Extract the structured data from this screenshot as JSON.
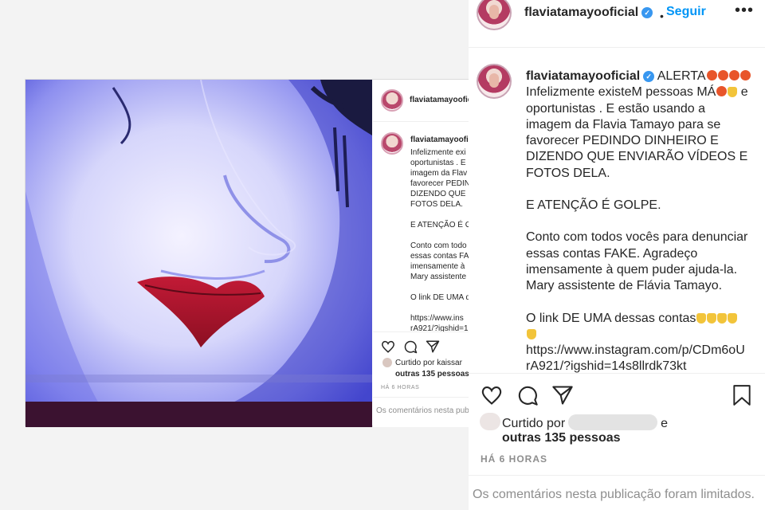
{
  "small_post": {
    "username": "flaviatamayoofici",
    "caption_username": "flaviatamayoofi",
    "caption_lines": "Infelizmente exi\noportunistas . E\nimagem da Flav\nfavorecer PEDIN\nDIZENDO QUE E\nFOTOS DELA.\n\nE ATENÇÃO É G\n\nConto com todo\nessas contas FA\nimensamente à\nMary assistente\n\nO link DE UMA d\n\nhttps://www.ins\nrA921/?igshid=1",
    "liked_by": "Curtido por kaissar",
    "liked_others": "outras 135 pessoas",
    "time": "HÁ 6 HORAS",
    "comments_limited": "Os comentários nesta pub"
  },
  "zoom_post": {
    "username": "flaviatamayooficial",
    "dot": "•",
    "follow": "Seguir",
    "more": "•••",
    "caption": {
      "username": "flaviatamayooficial",
      "first": "ALERTA",
      "line2a": "Infelizmente existeM pessoas MÁ",
      "line2b": " e",
      "body1": "oportunistas . E estão usando a\nimagem da Flavia Tamayo para se\nfavorecer PEDINDO DINHEIRO E\nDIZENDO QUE ENVIARÃO VÍDEOS E\nFOTOS DELA.",
      "alert": "E ATENÇÃO É GOLPE.",
      "body2": "Conto com todos vocês para denunciar\nessas contas FAKE. Agradeço\nimensamente à quem puder ajuda-la.\nMary assistente de Flávia Tamayo.",
      "link_intro": "O link DE UMA dessas contas",
      "link": "https://www.instagram.com/p/CDm6oU\nrA921/?igshid=14s8llrdk73kt"
    },
    "liked_prefix": "Curtido por",
    "liked_suffix": "e",
    "liked_others": "outras 135 pessoas",
    "time": "HÁ 6 HORAS",
    "comments_limited": "Os comentários nesta publicação foram limitados."
  },
  "icons": [
    "heart-icon",
    "comment-icon",
    "share-icon",
    "bookmark-icon",
    "verified-badge-icon",
    "more-options-icon"
  ],
  "colors": {
    "follow_blue": "#0095f6",
    "verified_blue": "#3897f0",
    "muted": "#8e8e8e",
    "text": "#262626",
    "lips_red": "#b0152c",
    "image_blue": "#5a5ee0"
  }
}
